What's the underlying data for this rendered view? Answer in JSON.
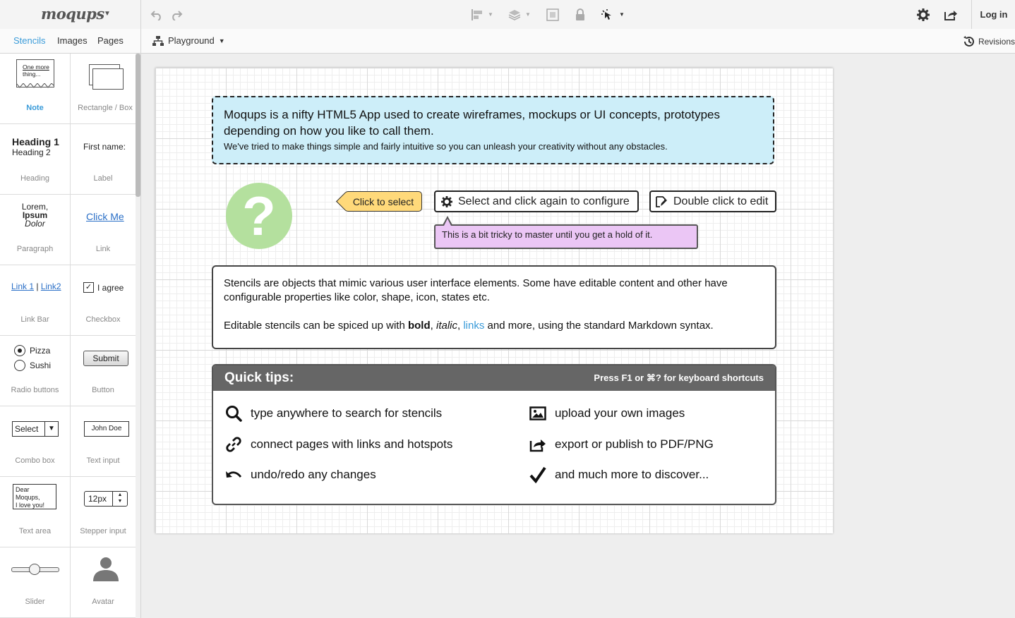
{
  "app": {
    "logo": "moqups",
    "login_label": "Log in"
  },
  "toolbar": {
    "icons": [
      "undo-icon",
      "redo-icon",
      "align-icon",
      "layers-icon",
      "group-icon",
      "lock-icon",
      "interaction-icon",
      "settings-icon",
      "share-icon"
    ]
  },
  "tabs": [
    {
      "label": "Stencils"
    },
    {
      "label": "Images"
    },
    {
      "label": "Pages"
    }
  ],
  "page_selector": {
    "label": "Playground"
  },
  "revisions_label": "Revisions",
  "stencils": {
    "note": {
      "caption": "Note",
      "text1": "One more",
      "text2": "thing..."
    },
    "rectangle": {
      "caption": "Rectangle / Box"
    },
    "heading": {
      "caption": "Heading",
      "h1": "Heading 1",
      "h2": "Heading 2"
    },
    "label": {
      "caption": "Label",
      "text": "First name:"
    },
    "paragraph": {
      "caption": "Paragraph",
      "w1": "Lorem,",
      "w2": "Ipsum",
      "w3": "Dolor"
    },
    "link": {
      "caption": "Link",
      "text": "Click Me"
    },
    "linkbar": {
      "caption": "Link Bar",
      "link1": "Link 1",
      "sep": "|",
      "link2": "Link2"
    },
    "checkbox": {
      "caption": "Checkbox",
      "text": "I agree"
    },
    "radio": {
      "caption": "Radio buttons",
      "opt1": "Pizza",
      "opt2": "Sushi"
    },
    "button": {
      "caption": "Button",
      "text": "Submit"
    },
    "combo": {
      "caption": "Combo box",
      "text": "Select"
    },
    "textinput": {
      "caption": "Text input",
      "text": "John Doe"
    },
    "textarea": {
      "caption": "Text area",
      "line1": "Dear Moqups,",
      "line2": "I love you!"
    },
    "stepper": {
      "caption": "Stepper input",
      "text": "12px"
    },
    "slider": {
      "caption": "Slider",
      "value": 0.5
    },
    "avatar": {
      "caption": "Avatar"
    }
  },
  "canvas": {
    "intro_line1": "Moqups is a nifty HTML5 App used to create wireframes, mockups or UI concepts, prototypes depending on how you like to call them.",
    "intro_line2": "We've tried to make things simple and fairly intuitive so you can unleash your creativity without any obstacles.",
    "qmark": "?",
    "click_to_select": "Click to select",
    "select_configure": "Select and click again to configure",
    "double_click": "Double click to edit",
    "tooltip": "This is a bit tricky to master until you get a hold of it.",
    "info_p1": "Stencils are objects that mimic various user interface elements. Some have editable content and other have configurable properties like color, shape, icon, states etc.",
    "info_p2_pre": "Editable stencils can be spiced up with ",
    "info_bold": "bold",
    "info_comma": ", ",
    "info_italic": "italic",
    "info_comma2": ", ",
    "info_link": "links",
    "info_post": " and more, using the standard Markdown syntax.",
    "quick_title": "Quick tips:",
    "quick_shortcut": "Press F1 or ⌘? for keyboard shortcuts",
    "tips": [
      {
        "text": "type anywhere to search for stencils",
        "icon": "search-icon"
      },
      {
        "text": "upload your own images",
        "icon": "image-icon"
      },
      {
        "text": "connect pages with links and hotspots",
        "icon": "link-icon"
      },
      {
        "text": "export or publish to PDF/PNG",
        "icon": "export-icon"
      },
      {
        "text": "undo/redo any changes",
        "icon": "undo-icon"
      },
      {
        "text": "and much more to discover...",
        "icon": "checkmark-icon"
      }
    ]
  },
  "colors": {
    "accent": "#3a9bd9",
    "intro_bg": "#cdeef9",
    "note_yellow": "#ffd97a",
    "tooltip_bg": "#ebc6f5",
    "qmark_green": "#b4e09e",
    "tips_header": "#666666"
  }
}
